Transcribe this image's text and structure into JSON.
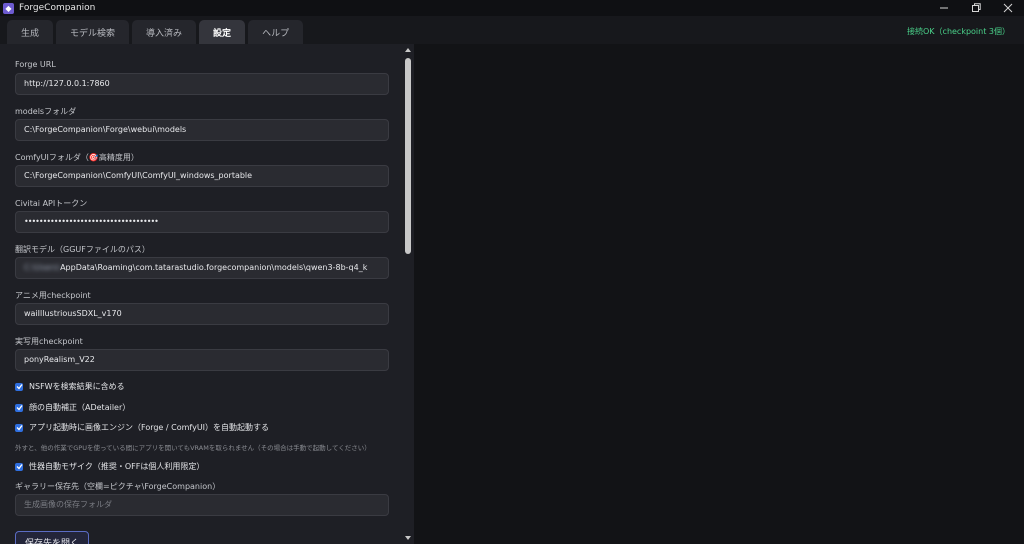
{
  "window": {
    "title": "ForgeCompanion",
    "logo_glyph": "◆"
  },
  "tabs": [
    {
      "label": "生成",
      "active": false
    },
    {
      "label": "モデル検索",
      "active": false
    },
    {
      "label": "導入済み",
      "active": false
    },
    {
      "label": "設定",
      "active": true
    },
    {
      "label": "ヘルプ",
      "active": false
    }
  ],
  "status": {
    "text": "接続OK（checkpoint 3個）",
    "color": "#4ad28a"
  },
  "settings": {
    "forge_url": {
      "label": "Forge URL",
      "value": "http://127.0.0.1:7860"
    },
    "models_folder": {
      "label": "modelsフォルダ",
      "value": "C:\\ForgeCompanion\\Forge\\webui\\models"
    },
    "comfy_folder": {
      "label": "ComfyUIフォルダ（🎯高精度用）",
      "value": "C:\\ForgeCompanion\\ComfyUI\\ComfyUI_windows_portable"
    },
    "civitai_token": {
      "label": "Civitai APIトークン",
      "value": "••••••••••••••••••••••••••••••••••••"
    },
    "translation_model": {
      "label": "翻訳モデル（GGUFファイルのパス）",
      "value_hidden": "C:\\Users\\",
      "value_visible": "AppData\\Roaming\\com.tatarastudio.forgecompanion\\models\\qwen3-8b-q4_k"
    },
    "anime_checkpoint": {
      "label": "アニメ用checkpoint",
      "value": "waiIllustriousSDXL_v170"
    },
    "real_checkpoint": {
      "label": "実写用checkpoint",
      "value": "ponyRealism_V22"
    },
    "checks": [
      {
        "label": "NSFWを検索結果に含める",
        "checked": true
      },
      {
        "label": "顔の自動補正（ADetailer）",
        "checked": true
      },
      {
        "label": "アプリ起動時に画像エンジン（Forge / ComfyUI）を自動起動する",
        "checked": true
      }
    ],
    "autostart_hint": "外すと、他の作業でGPUを使っている間にアプリを開いてもVRAMを取られません（その場合は手動で起動してください）",
    "mosaic": {
      "label": "性器自動モザイク（推奨・OFFは個人利用限定）",
      "checked": true
    },
    "gallery": {
      "label": "ギャラリー保存先（空欄=ピクチャ\\ForgeCompanion）",
      "placeholder": "生成画像の保存フォルダ"
    },
    "open_folder_button": "保存先を開く"
  },
  "colors": {
    "accent": "#2f6fe0",
    "panel_bg": "#1e1f25",
    "right_bg": "#121316"
  }
}
